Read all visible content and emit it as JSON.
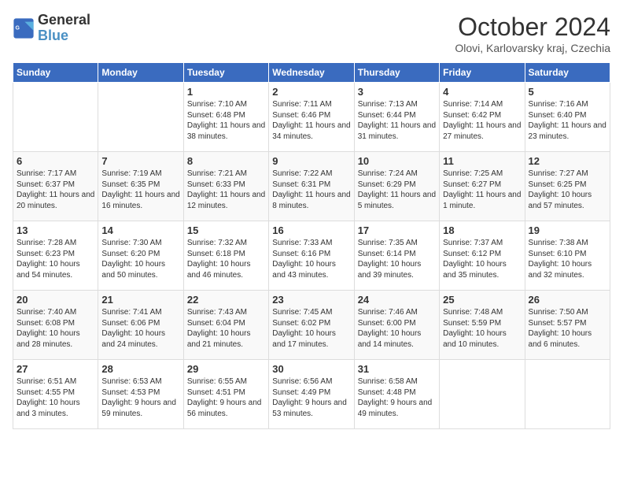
{
  "header": {
    "logo_line1": "General",
    "logo_line2": "Blue",
    "month": "October 2024",
    "location": "Olovi, Karlovarsky kraj, Czechia"
  },
  "weekdays": [
    "Sunday",
    "Monday",
    "Tuesday",
    "Wednesday",
    "Thursday",
    "Friday",
    "Saturday"
  ],
  "weeks": [
    [
      {
        "day": "",
        "sunrise": "",
        "sunset": "",
        "daylight": ""
      },
      {
        "day": "",
        "sunrise": "",
        "sunset": "",
        "daylight": ""
      },
      {
        "day": "1",
        "sunrise": "Sunrise: 7:10 AM",
        "sunset": "Sunset: 6:48 PM",
        "daylight": "Daylight: 11 hours and 38 minutes."
      },
      {
        "day": "2",
        "sunrise": "Sunrise: 7:11 AM",
        "sunset": "Sunset: 6:46 PM",
        "daylight": "Daylight: 11 hours and 34 minutes."
      },
      {
        "day": "3",
        "sunrise": "Sunrise: 7:13 AM",
        "sunset": "Sunset: 6:44 PM",
        "daylight": "Daylight: 11 hours and 31 minutes."
      },
      {
        "day": "4",
        "sunrise": "Sunrise: 7:14 AM",
        "sunset": "Sunset: 6:42 PM",
        "daylight": "Daylight: 11 hours and 27 minutes."
      },
      {
        "day": "5",
        "sunrise": "Sunrise: 7:16 AM",
        "sunset": "Sunset: 6:40 PM",
        "daylight": "Daylight: 11 hours and 23 minutes."
      }
    ],
    [
      {
        "day": "6",
        "sunrise": "Sunrise: 7:17 AM",
        "sunset": "Sunset: 6:37 PM",
        "daylight": "Daylight: 11 hours and 20 minutes."
      },
      {
        "day": "7",
        "sunrise": "Sunrise: 7:19 AM",
        "sunset": "Sunset: 6:35 PM",
        "daylight": "Daylight: 11 hours and 16 minutes."
      },
      {
        "day": "8",
        "sunrise": "Sunrise: 7:21 AM",
        "sunset": "Sunset: 6:33 PM",
        "daylight": "Daylight: 11 hours and 12 minutes."
      },
      {
        "day": "9",
        "sunrise": "Sunrise: 7:22 AM",
        "sunset": "Sunset: 6:31 PM",
        "daylight": "Daylight: 11 hours and 8 minutes."
      },
      {
        "day": "10",
        "sunrise": "Sunrise: 7:24 AM",
        "sunset": "Sunset: 6:29 PM",
        "daylight": "Daylight: 11 hours and 5 minutes."
      },
      {
        "day": "11",
        "sunrise": "Sunrise: 7:25 AM",
        "sunset": "Sunset: 6:27 PM",
        "daylight": "Daylight: 11 hours and 1 minute."
      },
      {
        "day": "12",
        "sunrise": "Sunrise: 7:27 AM",
        "sunset": "Sunset: 6:25 PM",
        "daylight": "Daylight: 10 hours and 57 minutes."
      }
    ],
    [
      {
        "day": "13",
        "sunrise": "Sunrise: 7:28 AM",
        "sunset": "Sunset: 6:23 PM",
        "daylight": "Daylight: 10 hours and 54 minutes."
      },
      {
        "day": "14",
        "sunrise": "Sunrise: 7:30 AM",
        "sunset": "Sunset: 6:20 PM",
        "daylight": "Daylight: 10 hours and 50 minutes."
      },
      {
        "day": "15",
        "sunrise": "Sunrise: 7:32 AM",
        "sunset": "Sunset: 6:18 PM",
        "daylight": "Daylight: 10 hours and 46 minutes."
      },
      {
        "day": "16",
        "sunrise": "Sunrise: 7:33 AM",
        "sunset": "Sunset: 6:16 PM",
        "daylight": "Daylight: 10 hours and 43 minutes."
      },
      {
        "day": "17",
        "sunrise": "Sunrise: 7:35 AM",
        "sunset": "Sunset: 6:14 PM",
        "daylight": "Daylight: 10 hours and 39 minutes."
      },
      {
        "day": "18",
        "sunrise": "Sunrise: 7:37 AM",
        "sunset": "Sunset: 6:12 PM",
        "daylight": "Daylight: 10 hours and 35 minutes."
      },
      {
        "day": "19",
        "sunrise": "Sunrise: 7:38 AM",
        "sunset": "Sunset: 6:10 PM",
        "daylight": "Daylight: 10 hours and 32 minutes."
      }
    ],
    [
      {
        "day": "20",
        "sunrise": "Sunrise: 7:40 AM",
        "sunset": "Sunset: 6:08 PM",
        "daylight": "Daylight: 10 hours and 28 minutes."
      },
      {
        "day": "21",
        "sunrise": "Sunrise: 7:41 AM",
        "sunset": "Sunset: 6:06 PM",
        "daylight": "Daylight: 10 hours and 24 minutes."
      },
      {
        "day": "22",
        "sunrise": "Sunrise: 7:43 AM",
        "sunset": "Sunset: 6:04 PM",
        "daylight": "Daylight: 10 hours and 21 minutes."
      },
      {
        "day": "23",
        "sunrise": "Sunrise: 7:45 AM",
        "sunset": "Sunset: 6:02 PM",
        "daylight": "Daylight: 10 hours and 17 minutes."
      },
      {
        "day": "24",
        "sunrise": "Sunrise: 7:46 AM",
        "sunset": "Sunset: 6:00 PM",
        "daylight": "Daylight: 10 hours and 14 minutes."
      },
      {
        "day": "25",
        "sunrise": "Sunrise: 7:48 AM",
        "sunset": "Sunset: 5:59 PM",
        "daylight": "Daylight: 10 hours and 10 minutes."
      },
      {
        "day": "26",
        "sunrise": "Sunrise: 7:50 AM",
        "sunset": "Sunset: 5:57 PM",
        "daylight": "Daylight: 10 hours and 6 minutes."
      }
    ],
    [
      {
        "day": "27",
        "sunrise": "Sunrise: 6:51 AM",
        "sunset": "Sunset: 4:55 PM",
        "daylight": "Daylight: 10 hours and 3 minutes."
      },
      {
        "day": "28",
        "sunrise": "Sunrise: 6:53 AM",
        "sunset": "Sunset: 4:53 PM",
        "daylight": "Daylight: 9 hours and 59 minutes."
      },
      {
        "day": "29",
        "sunrise": "Sunrise: 6:55 AM",
        "sunset": "Sunset: 4:51 PM",
        "daylight": "Daylight: 9 hours and 56 minutes."
      },
      {
        "day": "30",
        "sunrise": "Sunrise: 6:56 AM",
        "sunset": "Sunset: 4:49 PM",
        "daylight": "Daylight: 9 hours and 53 minutes."
      },
      {
        "day": "31",
        "sunrise": "Sunrise: 6:58 AM",
        "sunset": "Sunset: 4:48 PM",
        "daylight": "Daylight: 9 hours and 49 minutes."
      },
      {
        "day": "",
        "sunrise": "",
        "sunset": "",
        "daylight": ""
      },
      {
        "day": "",
        "sunrise": "",
        "sunset": "",
        "daylight": ""
      }
    ]
  ]
}
